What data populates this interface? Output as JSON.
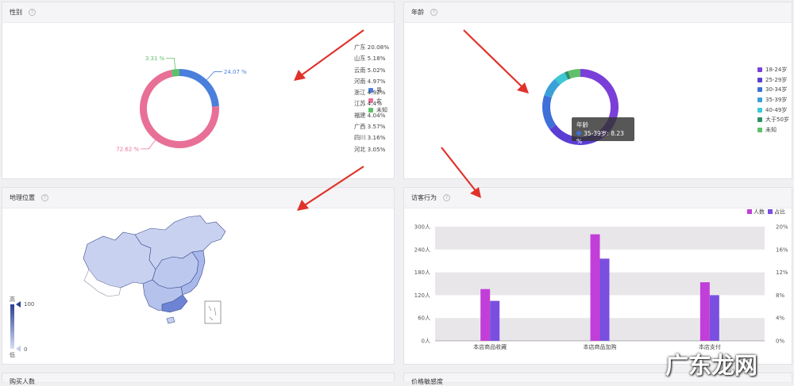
{
  "panels": {
    "gender": {
      "title": "性别"
    },
    "age": {
      "title": "年龄"
    },
    "geo": {
      "title": "地理位置"
    },
    "visitor": {
      "title": "访客行为"
    },
    "bottom_left": {
      "title": "购买人数"
    },
    "bottom_right": {
      "title": "价格敏感度"
    }
  },
  "help_icon": "question-circle-icon",
  "tooltip": {
    "title": "年龄",
    "text": "35-39岁: 8.23 %"
  },
  "map_scale": {
    "high_label": "高",
    "low_label": "低",
    "max": "100",
    "min": "0"
  },
  "watermark": "广东龙网",
  "colors": {
    "arrow": "#e0322b",
    "map_base": "#c8d2f0",
    "map_dark": "#6d84d4"
  },
  "chart_data": [
    {
      "type": "pie",
      "title": "",
      "donut": true,
      "slices": [
        {
          "name": "男",
          "value": 24.07,
          "label": "24.07 %",
          "color": "#4a7fdb"
        },
        {
          "name": "女",
          "value": 72.62,
          "label": "72.62 %",
          "color": "#e87097"
        },
        {
          "name": "未知",
          "value": 3.31,
          "label": "3.31 %",
          "color": "#5fbf6a"
        }
      ],
      "legend": "right"
    },
    {
      "type": "pie",
      "title": "",
      "donut": true,
      "slices": [
        {
          "name": "18-24岁",
          "value": 43.0,
          "color": "#7a3fd8"
        },
        {
          "name": "25-29岁",
          "value": 22.0,
          "color": "#5b3ed4"
        },
        {
          "name": "30-34岁",
          "value": 15.0,
          "color": "#3f6fd8"
        },
        {
          "name": "35-39岁",
          "value": 8.23,
          "color": "#3aa0d8"
        },
        {
          "name": "40-49岁",
          "value": 5.0,
          "color": "#3ec7d4"
        },
        {
          "name": "大于50岁",
          "value": 1.5,
          "color": "#2f8f6a"
        },
        {
          "name": "未知",
          "value": 5.27,
          "color": "#5fbf6a"
        }
      ],
      "legend": "right"
    },
    {
      "type": "table",
      "title": "",
      "rows": [
        {
          "region": "广东",
          "value": 20.08,
          "label": "广东 20.08%"
        },
        {
          "region": "山东",
          "value": 5.18,
          "label": "山东 5.18%"
        },
        {
          "region": "云南",
          "value": 5.02,
          "label": "云南 5.02%"
        },
        {
          "region": "河南",
          "value": 4.97,
          "label": "河南 4.97%"
        },
        {
          "region": "浙江",
          "value": 4.92,
          "label": "浙江 4.92%"
        },
        {
          "region": "江苏",
          "value": 4.4,
          "label": "江苏 4.4%"
        },
        {
          "region": "福建",
          "value": 4.04,
          "label": "福建 4.04%"
        },
        {
          "region": "广西",
          "value": 3.57,
          "label": "广西 3.57%"
        },
        {
          "region": "四川",
          "value": 3.16,
          "label": "四川 3.16%"
        },
        {
          "region": "河北",
          "value": 3.05,
          "label": "河北 3.05%"
        }
      ]
    },
    {
      "type": "bar",
      "title": "",
      "categories": [
        "本店商品收藏",
        "本店商品加购",
        "本店支付"
      ],
      "series": [
        {
          "name": "人数",
          "values": [
            136,
            280,
            154
          ],
          "color": "#c13fd8",
          "axis": "left"
        },
        {
          "name": "占比",
          "values": [
            7.0,
            14.4,
            8.0
          ],
          "color": "#7a4fe0",
          "axis": "right"
        }
      ],
      "ylim": [
        0,
        300
      ],
      "yticks": [
        "0人",
        "60人",
        "120人",
        "180人",
        "240人",
        "300人"
      ],
      "y2lim": [
        0,
        20
      ],
      "y2ticks": [
        "0%",
        "4%",
        "8%",
        "12%",
        "16%",
        "20%"
      ],
      "legend": "top-right",
      "grid": true
    }
  ]
}
